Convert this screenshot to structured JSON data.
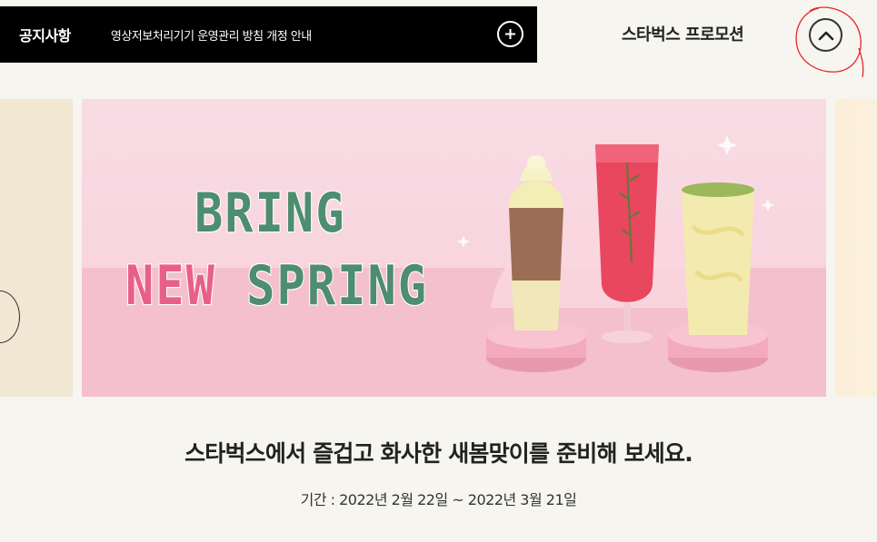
{
  "notice": {
    "title": "공지사항",
    "text": "영상저보처리기기 운영관리 방침 개정 안내"
  },
  "promotion": {
    "title": "스타벅스 프로모션"
  },
  "banner": {
    "line1": "BRING",
    "line2_word1": "NEW",
    "line2_word2": "SPRING"
  },
  "copy": {
    "headline": "스타벅스에서 즐겁고 화사한 새봄맞이를 준비해 보세요.",
    "period": "기간 : 2022년 2월 22일 ~ 2022년 3월 21일"
  },
  "colors": {
    "notice_bg": "#000000",
    "page_bg": "#f6f5ef",
    "banner_pink": "#f8d5df",
    "bring_green": "#4e8d70",
    "new_pink": "#e85f89",
    "annotation_red": "#e8262b"
  },
  "icons": {
    "notice_more": "plus-circle-icon",
    "promo_toggle": "chevron-up-icon",
    "slider_prev": "chevron-left-icon"
  }
}
